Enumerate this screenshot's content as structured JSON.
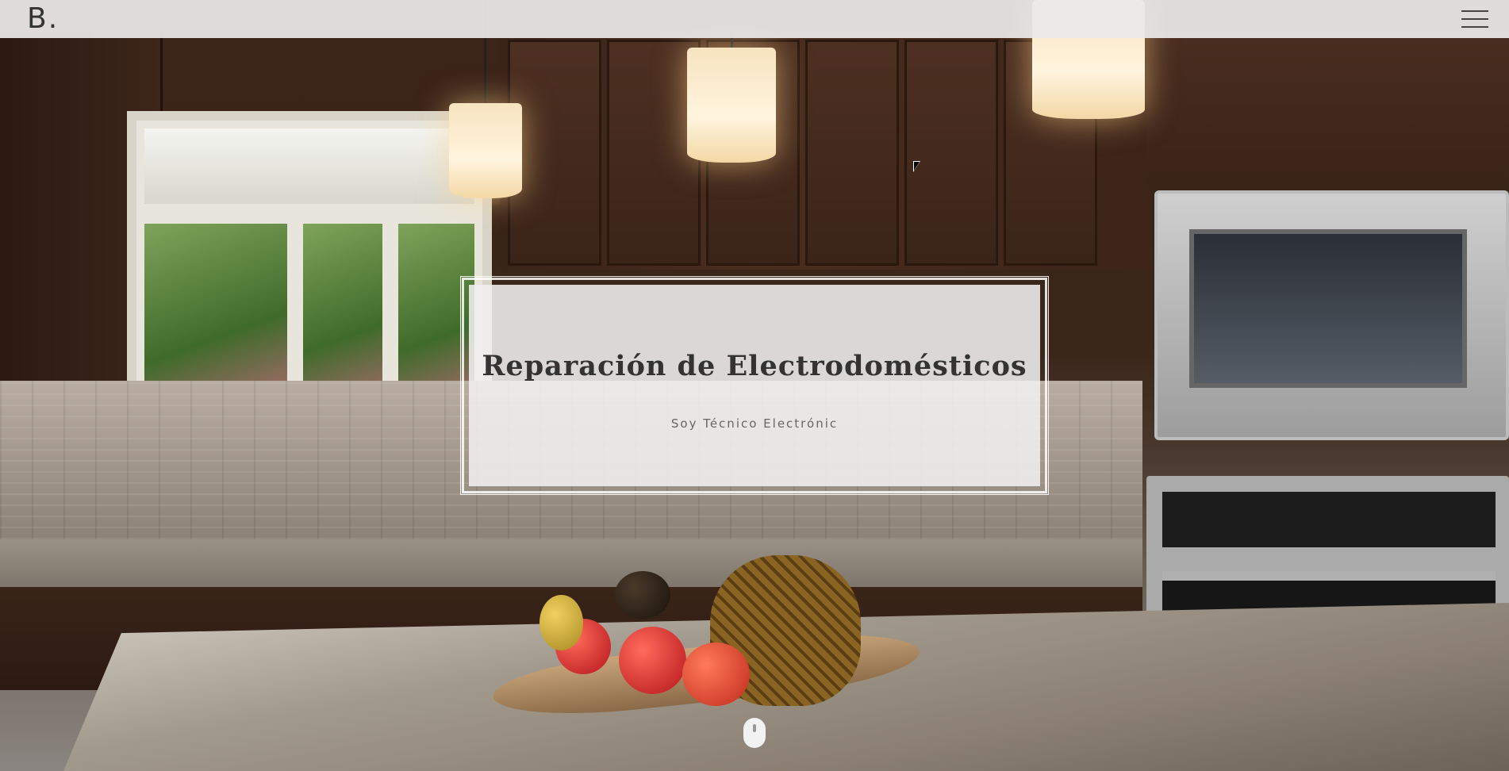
{
  "header": {
    "logo_text": "B.",
    "menu_icon": "hamburger-menu-icon"
  },
  "hero": {
    "title": "Reparación de Electrodomésticos",
    "subtitle": "Soy Técnico Electrónic",
    "scroll_icon": "mouse-scroll-icon"
  },
  "colors": {
    "topbar_bg": "#ebeaea",
    "card_bg": "#f0f0f0",
    "text_dark": "#333333",
    "text_muted": "#666666"
  }
}
